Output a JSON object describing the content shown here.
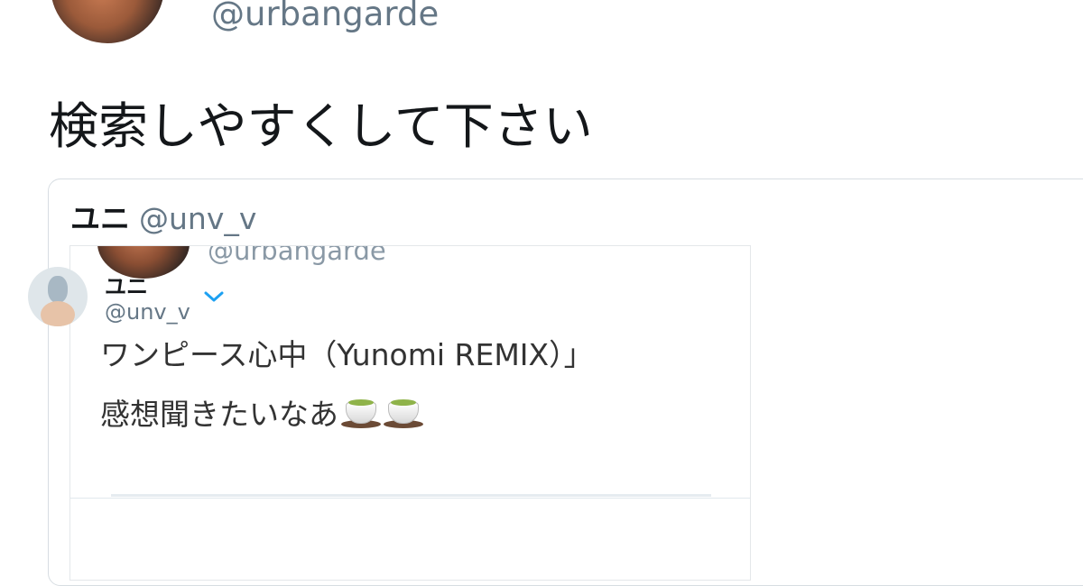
{
  "tweet": {
    "handle": "@urbangarde",
    "text": "検索しやすくして下さい"
  },
  "quote": {
    "name": "ユニ",
    "handle": "@unv_v",
    "screenshot": {
      "handle": "@urbangarde",
      "line1": "ワンピース心中（Yunomi REMIX）」",
      "line2": "感想聞きたいなあ",
      "emoji": "teacup-icon",
      "reply": {
        "name": "ユニ",
        "handle": "@unv_v",
        "menu_icon": "chevron-down-icon"
      }
    }
  },
  "colors": {
    "text": "#14171a",
    "secondary": "#657786",
    "border": "#d7dde2",
    "accent": "#1da1f2"
  }
}
